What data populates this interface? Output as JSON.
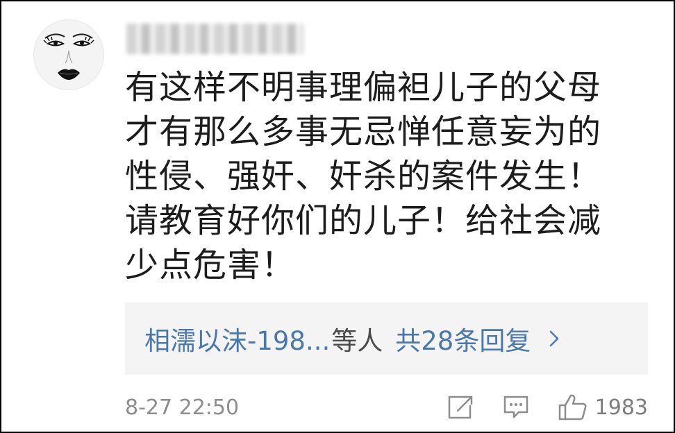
{
  "comment": {
    "text": "有这样不明事理偏袒儿子的父母\n才有那么多事无忌惮任意妄为的\n性侵、强奸、奸杀的案件发生！\n请教育好你们的儿子！给社会减\n少点危害！"
  },
  "replies": {
    "who": "相濡以沫-198...",
    "suffix": "等人",
    "count_label": "共28条回复"
  },
  "meta": {
    "timestamp": "8-27 22:50",
    "likes": "1983"
  },
  "icons": {
    "share": "share-icon",
    "reply": "comment-icon",
    "like": "thumbs-up-icon",
    "arrow": "chevron-right-icon"
  },
  "colors": {
    "link": "#4a78a8",
    "muted": "#8c8c8c",
    "reply_bg": "#f4f4f4"
  }
}
